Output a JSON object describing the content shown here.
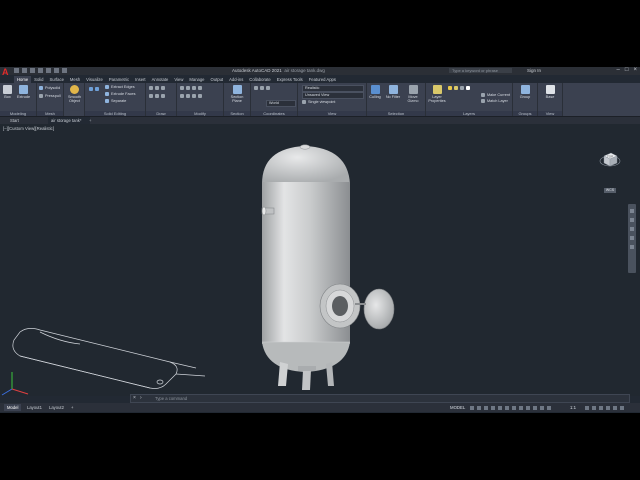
{
  "app": {
    "logo_letter": "A",
    "title": "Autodesk AutoCAD 2021",
    "document": "air storage tank.dwg",
    "search_placeholder": "Type a keyword or phrase",
    "sign_in": "Sign In"
  },
  "ribbon_tabs": [
    "Home",
    "Solid",
    "Surface",
    "Mesh",
    "Visualize",
    "Parametric",
    "Insert",
    "Annotate",
    "View",
    "Manage",
    "Output",
    "Add-ins",
    "Collaborate",
    "Express Tools",
    "Featured Apps"
  ],
  "ribbon": {
    "box": "Box",
    "extrude": "Extrude",
    "polysolid": "Polysolid",
    "presspull": "Presspull",
    "smooth_object": "Smooth Object",
    "extract_edges": "Extract Edges",
    "extrude_faces": "Extrude Faces",
    "separate": "Separate",
    "section_plane": "Section Plane",
    "visual_style": "Realistic",
    "view": "Unsaved View",
    "world": "World",
    "single_viewpoint": "Single viewpoint",
    "culling": "Culling",
    "no_filter": "No Filter",
    "move_gizmo": "Move Gizmo",
    "layer_properties": "Layer Properties",
    "make_current": "Make Current",
    "match_layer": "Match Layer",
    "group": "Group",
    "base": "Base",
    "panels": {
      "modeling": "Modeling",
      "mesh": "Mesh",
      "solid_editing": "Solid Editing",
      "draw": "Draw",
      "modify": "Modify",
      "section": "Section",
      "coordinates": "Coordinates",
      "view": "View",
      "selection": "Selection",
      "layers": "Layers",
      "groups": "Groups",
      "view2": "View"
    }
  },
  "file_tabs": [
    "Start",
    "air storage tank*"
  ],
  "viewport": {
    "label": "[–][Custom View][Realistic]",
    "wcs": "WCS",
    "cube_face": "TOP"
  },
  "command": {
    "prompt": "Type a command"
  },
  "status": {
    "layout_tabs": [
      "Model",
      "Layout1",
      "Layout2"
    ],
    "model": "MODEL",
    "scale": "1:1"
  },
  "colors": {
    "app_bg": "#222933",
    "ribbon_bg": "#3b4150",
    "accent_red": "#e32b2b",
    "tank": "#c9cbcc"
  }
}
